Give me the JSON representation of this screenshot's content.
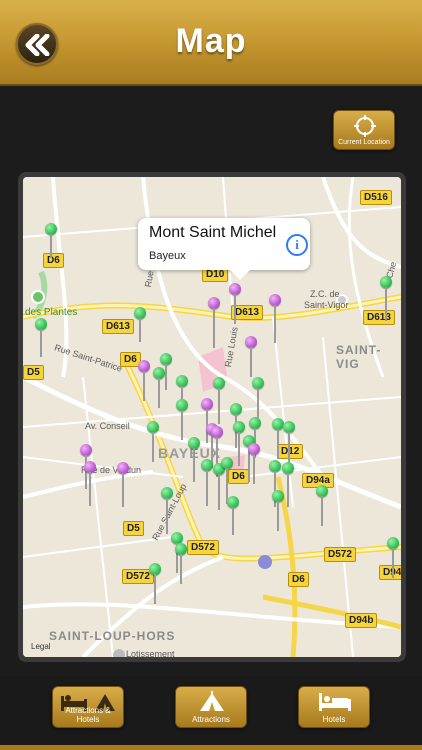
{
  "header": {
    "title": "Map"
  },
  "location_button": {
    "label": "Current Location"
  },
  "map": {
    "callout": {
      "title": "Mont Saint Michel",
      "subtitle": "Bayeux",
      "info_symbol": "i"
    },
    "road_labels": [
      "D6",
      "D613",
      "D6",
      "D5",
      "D613",
      "D613",
      "D516",
      "D10",
      "D12",
      "D94a",
      "D5",
      "D572",
      "D572",
      "D572",
      "D6",
      "D94b",
      "D6",
      "D94"
    ],
    "place_labels": {
      "bayeux": "BAYEUX",
      "saint_vigor": "SAINT-VIG",
      "saint_loup": "SAINT-LOUP-HORS",
      "zc": "Z.C. de",
      "zc2": "Saint-Vigor",
      "lotissement": "Lotissement"
    },
    "green_place": "des Plantes",
    "streets": {
      "patrice": "Rue Saint-Patrice",
      "conseil": "Av. Conseil",
      "verdun": "Rue de Verdun",
      "saintloup": "Rue Saint-Loup",
      "rue": "Rue",
      "louis": "Rue Louis",
      "che": "Che"
    },
    "legal": "Legal"
  },
  "tabs": [
    {
      "label": "Attractions & Hotels",
      "icon": "bed-tent-icon"
    },
    {
      "label": "Attractions",
      "icon": "tent-icon"
    },
    {
      "label": "Hotels",
      "icon": "bed-icon"
    }
  ],
  "colors": {
    "gold": "#c89a33",
    "green_pin": "#22b94a",
    "purple_pin": "#b24ecb"
  }
}
